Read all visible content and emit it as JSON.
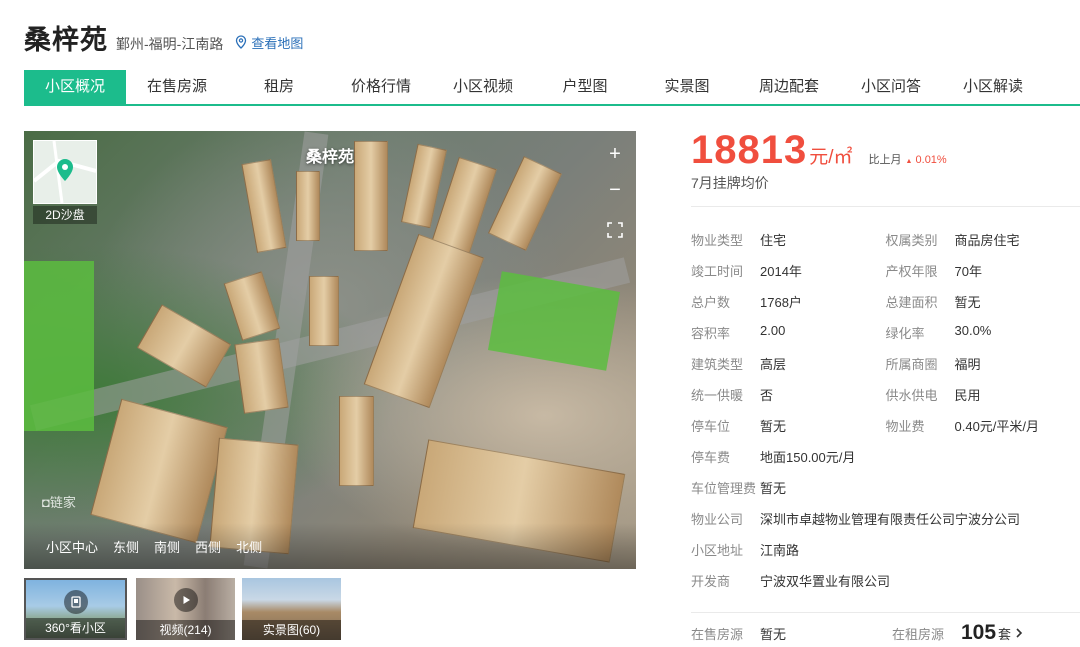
{
  "header": {
    "title": "桑梓苑",
    "location": "鄞州-福明-江南路",
    "map_link": "查看地图"
  },
  "tabs": [
    {
      "label": "小区概况",
      "active": true
    },
    {
      "label": "在售房源"
    },
    {
      "label": "租房"
    },
    {
      "label": "价格行情"
    },
    {
      "label": "小区视频"
    },
    {
      "label": "户型图"
    },
    {
      "label": "实景图"
    },
    {
      "label": "周边配套"
    },
    {
      "label": "小区问答"
    },
    {
      "label": "小区解读"
    }
  ],
  "hero": {
    "name": "桑梓苑",
    "minimap_label": "2D沙盘",
    "zoom_in": "+",
    "zoom_out": "−",
    "watermark": "◘链家",
    "directions": [
      "小区中心",
      "东侧",
      "南侧",
      "西侧",
      "北侧"
    ]
  },
  "thumbnails": [
    {
      "label": "360°看小区",
      "icon": "panorama-icon"
    },
    {
      "label": "视频(214)",
      "icon": "play-icon"
    },
    {
      "label": "实景图(60)",
      "icon": "photo"
    }
  ],
  "price": {
    "value": "18813",
    "unit": "元/㎡",
    "mom_label": "比上月",
    "mom_arrow": "▲",
    "mom_value": "0.01%",
    "description": "7月挂牌均价"
  },
  "info": {
    "rows": [
      [
        {
          "label": "物业类型",
          "value": "住宅"
        },
        {
          "label": "权属类别",
          "value": "商品房住宅"
        }
      ],
      [
        {
          "label": "竣工时间",
          "value": "2014年"
        },
        {
          "label": "产权年限",
          "value": "70年"
        }
      ],
      [
        {
          "label": "总户数",
          "value": "1768户"
        },
        {
          "label": "总建面积",
          "value": "暂无"
        }
      ],
      [
        {
          "label": "容积率",
          "value": "2.00"
        },
        {
          "label": "绿化率",
          "value": "30.0%"
        }
      ],
      [
        {
          "label": "建筑类型",
          "value": "高层"
        },
        {
          "label": "所属商圈",
          "value": "福明"
        }
      ],
      [
        {
          "label": "统一供暖",
          "value": "否"
        },
        {
          "label": "供水供电",
          "value": "民用"
        }
      ],
      [
        {
          "label": "停车位",
          "value": "暂无"
        },
        {
          "label": "物业费",
          "value": "0.40元/平米/月"
        }
      ]
    ],
    "wide_rows": [
      {
        "label": "停车费",
        "value": "地面150.00元/月"
      },
      {
        "label": "车位管理费",
        "value": "暂无"
      },
      {
        "label": "物业公司",
        "value": "深圳市卓越物业管理有限责任公司宁波分公司"
      },
      {
        "label": "小区地址",
        "value": "江南路"
      },
      {
        "label": "开发商",
        "value": "宁波双华置业有限公司"
      }
    ]
  },
  "listings": {
    "sale_label": "在售房源",
    "sale_value": "暂无",
    "rent_label": "在租房源",
    "rent_count": "105",
    "rent_unit": "套"
  },
  "colors": {
    "accent": "#1cbc8c",
    "price": "#f04e3e",
    "link": "#2a6fb8"
  }
}
